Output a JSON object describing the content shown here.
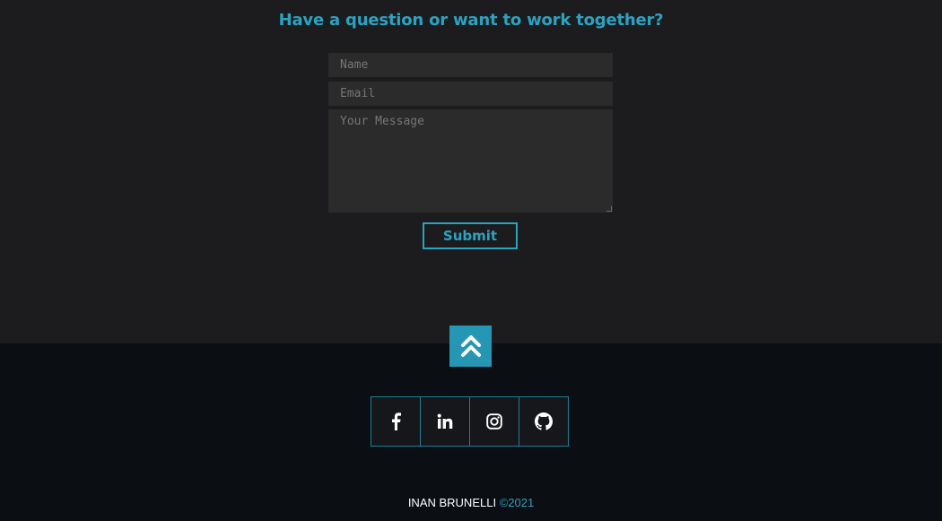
{
  "contact": {
    "title": "Have a question or want to work together?",
    "name_placeholder": "Name",
    "email_placeholder": "Email",
    "message_placeholder": "Your Message",
    "submit_label": "Submit"
  },
  "back_to_top": {
    "icon": "double-chevron-up-icon"
  },
  "social": [
    {
      "name": "facebook",
      "icon": "facebook-icon"
    },
    {
      "name": "linkedin",
      "icon": "linkedin-icon"
    },
    {
      "name": "instagram",
      "icon": "instagram-icon"
    },
    {
      "name": "github",
      "icon": "github-icon"
    }
  ],
  "footer": {
    "name": "INAN BRUNELLI",
    "year": "©2021"
  },
  "colors": {
    "accent": "#2aa3c0",
    "section_bg": "#1c1c1e",
    "footer_bg": "#0b0e12",
    "field_bg": "#2b2b2c"
  }
}
